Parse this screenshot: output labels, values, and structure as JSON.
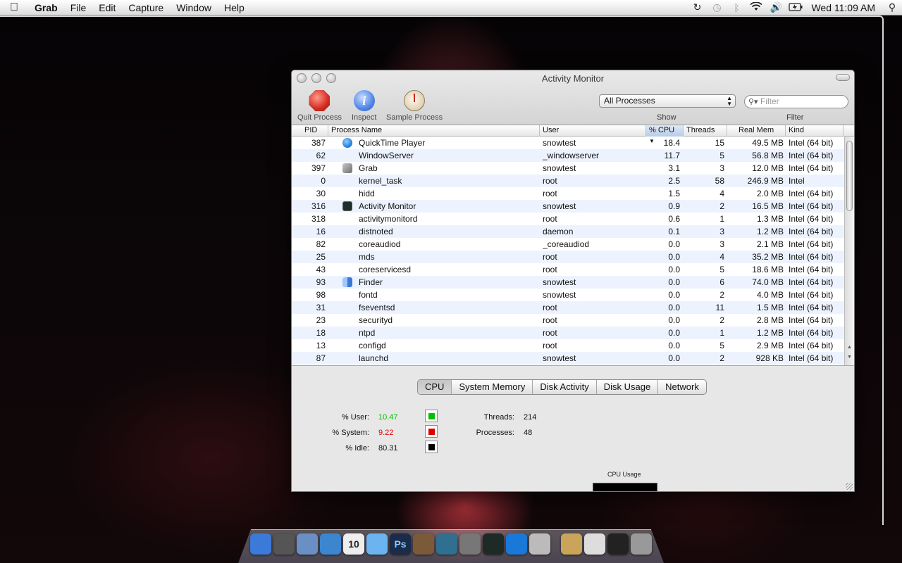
{
  "menubar": {
    "app": "Grab",
    "items": [
      "File",
      "Edit",
      "Capture",
      "Window",
      "Help"
    ],
    "clock": "Wed 11:09 AM"
  },
  "window": {
    "title": "Activity Monitor",
    "toolbar": {
      "quit_label": "Quit Process",
      "inspect_label": "Inspect",
      "sample_label": "Sample Process",
      "process_filter": "All Processes",
      "filter_placeholder": "Filter",
      "show_label": "Show",
      "filter_label": "Filter"
    },
    "table": {
      "headers": [
        "PID",
        "Process Name",
        "User",
        "% CPU",
        "Threads",
        "Real Mem",
        "Kind"
      ],
      "rows": [
        {
          "pid": "387",
          "name": "QuickTime Player",
          "icon": "quicktime-icon",
          "user": "snowtest",
          "cpu": "18.4",
          "threads": "15",
          "mem": "49.5 MB",
          "kind": "Intel (64 bit)"
        },
        {
          "pid": "62",
          "name": "WindowServer",
          "icon": "",
          "user": "_windowserver",
          "cpu": "11.7",
          "threads": "5",
          "mem": "56.8 MB",
          "kind": "Intel (64 bit)"
        },
        {
          "pid": "397",
          "name": "Grab",
          "icon": "grab-icon",
          "user": "snowtest",
          "cpu": "3.1",
          "threads": "3",
          "mem": "12.0 MB",
          "kind": "Intel (64 bit)"
        },
        {
          "pid": "0",
          "name": "kernel_task",
          "icon": "",
          "user": "root",
          "cpu": "2.5",
          "threads": "58",
          "mem": "246.9 MB",
          "kind": "Intel"
        },
        {
          "pid": "30",
          "name": "hidd",
          "icon": "",
          "user": "root",
          "cpu": "1.5",
          "threads": "4",
          "mem": "2.0 MB",
          "kind": "Intel (64 bit)"
        },
        {
          "pid": "316",
          "name": "Activity Monitor",
          "icon": "activity-monitor-icon",
          "user": "snowtest",
          "cpu": "0.9",
          "threads": "2",
          "mem": "16.5 MB",
          "kind": "Intel (64 bit)"
        },
        {
          "pid": "318",
          "name": "activitymonitord",
          "icon": "",
          "user": "root",
          "cpu": "0.6",
          "threads": "1",
          "mem": "1.3 MB",
          "kind": "Intel (64 bit)"
        },
        {
          "pid": "16",
          "name": "distnoted",
          "icon": "",
          "user": "daemon",
          "cpu": "0.1",
          "threads": "3",
          "mem": "1.2 MB",
          "kind": "Intel (64 bit)"
        },
        {
          "pid": "82",
          "name": "coreaudiod",
          "icon": "",
          "user": "_coreaudiod",
          "cpu": "0.0",
          "threads": "3",
          "mem": "2.1 MB",
          "kind": "Intel (64 bit)"
        },
        {
          "pid": "25",
          "name": "mds",
          "icon": "",
          "user": "root",
          "cpu": "0.0",
          "threads": "4",
          "mem": "35.2 MB",
          "kind": "Intel (64 bit)"
        },
        {
          "pid": "43",
          "name": "coreservicesd",
          "icon": "",
          "user": "root",
          "cpu": "0.0",
          "threads": "5",
          "mem": "18.6 MB",
          "kind": "Intel (64 bit)"
        },
        {
          "pid": "93",
          "name": "Finder",
          "icon": "finder-icon",
          "user": "snowtest",
          "cpu": "0.0",
          "threads": "6",
          "mem": "74.0 MB",
          "kind": "Intel (64 bit)"
        },
        {
          "pid": "98",
          "name": "fontd",
          "icon": "",
          "user": "snowtest",
          "cpu": "0.0",
          "threads": "2",
          "mem": "4.0 MB",
          "kind": "Intel (64 bit)"
        },
        {
          "pid": "31",
          "name": "fseventsd",
          "icon": "",
          "user": "root",
          "cpu": "0.0",
          "threads": "11",
          "mem": "1.5 MB",
          "kind": "Intel (64 bit)"
        },
        {
          "pid": "23",
          "name": "securityd",
          "icon": "",
          "user": "root",
          "cpu": "0.0",
          "threads": "2",
          "mem": "2.8 MB",
          "kind": "Intel (64 bit)"
        },
        {
          "pid": "18",
          "name": "ntpd",
          "icon": "",
          "user": "root",
          "cpu": "0.0",
          "threads": "1",
          "mem": "1.2 MB",
          "kind": "Intel (64 bit)"
        },
        {
          "pid": "13",
          "name": "configd",
          "icon": "",
          "user": "root",
          "cpu": "0.0",
          "threads": "5",
          "mem": "2.9 MB",
          "kind": "Intel (64 bit)"
        },
        {
          "pid": "87",
          "name": "launchd",
          "icon": "",
          "user": "snowtest",
          "cpu": "0.0",
          "threads": "2",
          "mem": "928 KB",
          "kind": "Intel (64 bit)"
        }
      ]
    },
    "tabs": [
      "CPU",
      "System Memory",
      "Disk Activity",
      "Disk Usage",
      "Network"
    ],
    "active_tab": "CPU",
    "cpu": {
      "user_label": "% User:",
      "user_value": "10.47",
      "user_color": "#00c000",
      "system_label": "% System:",
      "system_value": "9.22",
      "system_color": "#e00000",
      "idle_label": "% Idle:",
      "idle_value": "80.31",
      "idle_color": "#000000",
      "threads_label": "Threads:",
      "threads_value": "214",
      "processes_label": "Processes:",
      "processes_value": "48",
      "graph_title": "CPU Usage"
    }
  },
  "dock": {
    "icons": [
      "finder-icon",
      "dashboard-icon",
      "mail-icon",
      "safari-icon",
      "ical-icon",
      "itunes-icon",
      "photoshop-icon",
      "iphoto-icon",
      "time-machine-icon",
      "system-preferences-icon",
      "activity-monitor-icon",
      "quicktime-icon",
      "grab-icon",
      "applications-folder-icon",
      "documents-stack-icon",
      "music-stack-icon",
      "trash-icon"
    ],
    "ical_date": "10",
    "ps_label": "Ps"
  }
}
